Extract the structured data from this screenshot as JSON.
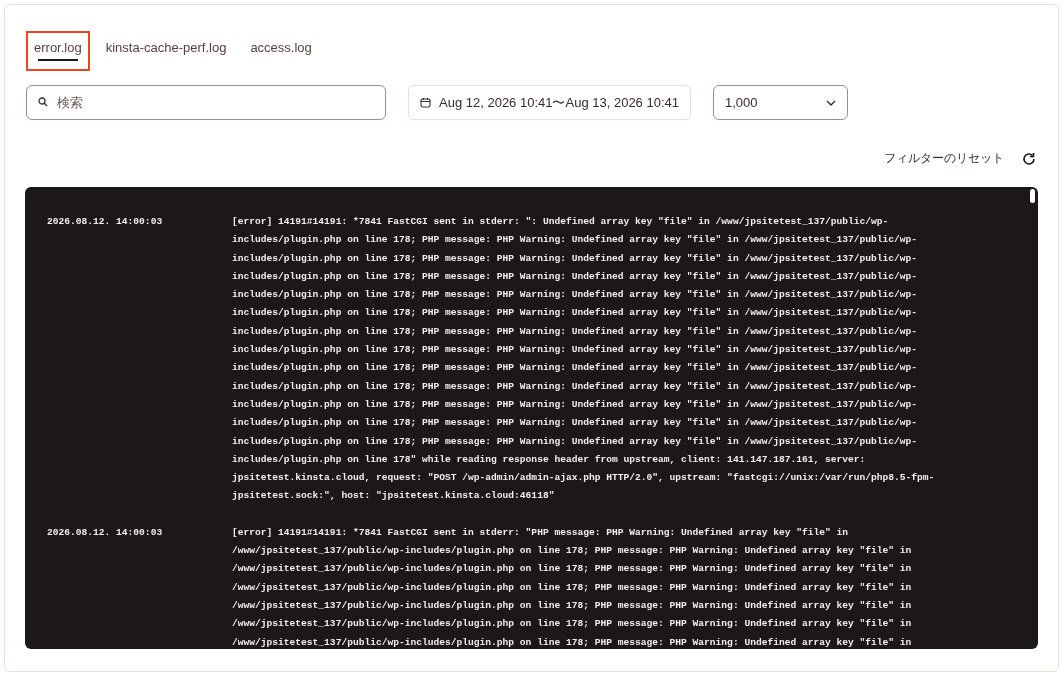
{
  "tabs": [
    {
      "label": "error.log",
      "selected": true,
      "highlighted": true
    },
    {
      "label": "kinsta-cache-perf.log",
      "selected": false,
      "highlighted": false
    },
    {
      "label": "access.log",
      "selected": false,
      "highlighted": false
    }
  ],
  "search": {
    "placeholder": "検索"
  },
  "date_range": {
    "value": "Aug 12, 2026 10:41〜Aug 13, 2026 10:41"
  },
  "limit_select": {
    "value": "1,000"
  },
  "reset_filters": {
    "label": "フィルターのリセット"
  },
  "log_entries": [
    {
      "timestamp": "2026.08.12. 14:00:03",
      "lines": [
        "[error] 14191#14191: *7841 FastCGI sent in stderr: \": Undefined array key \"file\" in /www/jpsitetest_137/public/wp-",
        "includes/plugin.php on line 178; PHP message: PHP Warning: Undefined array key \"file\" in /www/jpsitetest_137/public/wp-",
        "includes/plugin.php on line 178; PHP message: PHP Warning: Undefined array key \"file\" in /www/jpsitetest_137/public/wp-",
        "includes/plugin.php on line 178; PHP message: PHP Warning: Undefined array key \"file\" in /www/jpsitetest_137/public/wp-",
        "includes/plugin.php on line 178; PHP message: PHP Warning: Undefined array key \"file\" in /www/jpsitetest_137/public/wp-",
        "includes/plugin.php on line 178; PHP message: PHP Warning: Undefined array key \"file\" in /www/jpsitetest_137/public/wp-",
        "includes/plugin.php on line 178; PHP message: PHP Warning: Undefined array key \"file\" in /www/jpsitetest_137/public/wp-",
        "includes/plugin.php on line 178; PHP message: PHP Warning: Undefined array key \"file\" in /www/jpsitetest_137/public/wp-",
        "includes/plugin.php on line 178; PHP message: PHP Warning: Undefined array key \"file\" in /www/jpsitetest_137/public/wp-",
        "includes/plugin.php on line 178; PHP message: PHP Warning: Undefined array key \"file\" in /www/jpsitetest_137/public/wp-",
        "includes/plugin.php on line 178; PHP message: PHP Warning: Undefined array key \"file\" in /www/jpsitetest_137/public/wp-",
        "includes/plugin.php on line 178; PHP message: PHP Warning: Undefined array key \"file\" in /www/jpsitetest_137/public/wp-",
        "includes/plugin.php on line 178; PHP message: PHP Warning: Undefined array key \"file\" in /www/jpsitetest_137/public/wp-",
        "includes/plugin.php on line 178\" while reading response header from upstream, client: 141.147.187.161, server:",
        "jpsitetest.kinsta.cloud, request: \"POST /wp-admin/admin-ajax.php HTTP/2.0\", upstream: \"fastcgi://unix:/var/run/php8.5-fpm-",
        "jpsitetest.sock:\", host: \"jpsitetest.kinsta.cloud:46118\""
      ]
    },
    {
      "timestamp": "2026.08.12. 14:00:03",
      "lines": [
        "[error] 14191#14191: *7841 FastCGI sent in stderr: \"PHP message: PHP Warning: Undefined array key \"file\" in",
        "/www/jpsitetest_137/public/wp-includes/plugin.php on line 178; PHP message: PHP Warning: Undefined array key \"file\" in",
        "/www/jpsitetest_137/public/wp-includes/plugin.php on line 178; PHP message: PHP Warning: Undefined array key \"file\" in",
        "/www/jpsitetest_137/public/wp-includes/plugin.php on line 178; PHP message: PHP Warning: Undefined array key \"file\" in",
        "/www/jpsitetest_137/public/wp-includes/plugin.php on line 178; PHP message: PHP Warning: Undefined array key \"file\" in",
        "/www/jpsitetest_137/public/wp-includes/plugin.php on line 178; PHP message: PHP Warning: Undefined array key \"file\" in",
        "/www/jpsitetest_137/public/wp-includes/plugin.php on line 178; PHP message: PHP Warning: Undefined array key \"file\" in"
      ]
    }
  ]
}
